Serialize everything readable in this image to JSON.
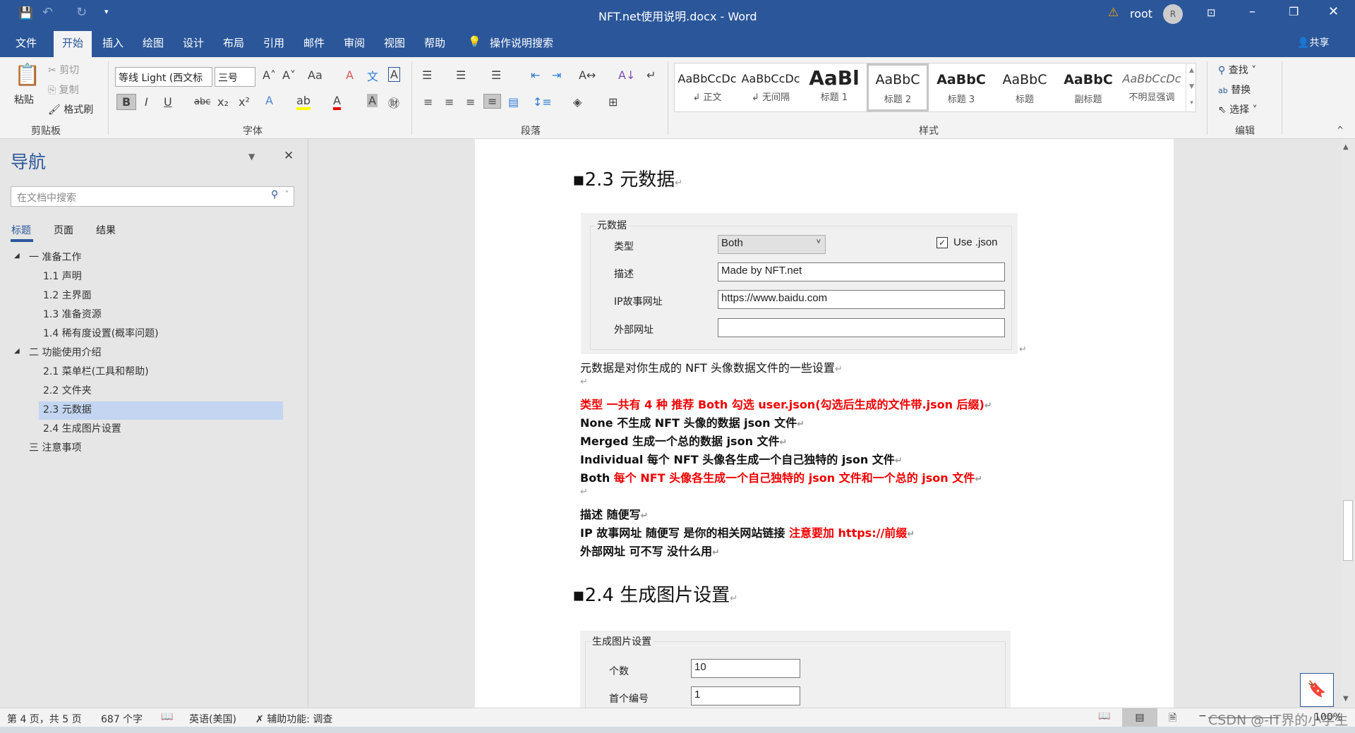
{
  "titlebar": {
    "title": "NFT.net使用说明.docx  -  Word",
    "user": "root",
    "avatar_initial": "R",
    "share": "共享"
  },
  "tabs": [
    "文件",
    "开始",
    "插入",
    "绘图",
    "设计",
    "布局",
    "引用",
    "邮件",
    "审阅",
    "视图",
    "帮助"
  ],
  "tell_me": "操作说明搜索",
  "ribbon": {
    "clipboard": {
      "paste": "粘贴",
      "cut": "剪切",
      "copy": "复制",
      "format_painter": "格式刷",
      "label": "剪贴板"
    },
    "font": {
      "name": "等线 Light (西文标",
      "size": "三号",
      "label": "字体"
    },
    "paragraph": {
      "label": "段落"
    },
    "styles": {
      "label": "样式",
      "items": [
        {
          "sample": "AaBbCcDc",
          "name": "↲ 正文"
        },
        {
          "sample": "AaBbCcDc",
          "name": "↲ 无间隔"
        },
        {
          "sample": "AaBl",
          "name": "标题 1"
        },
        {
          "sample": "AaBbC",
          "name": "标题 2"
        },
        {
          "sample": "AaBbC",
          "name": "标题 3"
        },
        {
          "sample": "AaBbC",
          "name": "标题"
        },
        {
          "sample": "AaBbC",
          "name": "副标题"
        },
        {
          "sample": "AaBbCcDc",
          "name": "不明显强调"
        }
      ]
    },
    "editing": {
      "find": "查找",
      "replace": "替换",
      "select": "选择",
      "label": "编辑"
    }
  },
  "nav": {
    "title": "导航",
    "search_placeholder": "在文档中搜索",
    "tabs": [
      "标题",
      "页面",
      "结果"
    ],
    "items": [
      {
        "label": "一 准备工作",
        "level": 1,
        "expanded": true
      },
      {
        "label": "1.1 声明",
        "level": 2
      },
      {
        "label": "1.2 主界面",
        "level": 2
      },
      {
        "label": "1.3 准备资源",
        "level": 2
      },
      {
        "label": "1.4 稀有度设置(概率问题)",
        "level": 2
      },
      {
        "label": "二 功能使用介绍",
        "level": 1,
        "expanded": true
      },
      {
        "label": "2.1 菜单栏(工具和帮助)",
        "level": 2
      },
      {
        "label": "2.2 文件夹",
        "level": 2
      },
      {
        "label": "2.3 元数据",
        "level": 2,
        "selected": true
      },
      {
        "label": "2.4 生成图片设置",
        "level": 2
      },
      {
        "label": "三 注意事项",
        "level": 1
      }
    ]
  },
  "doc": {
    "h23": "2.3  元数据",
    "form1": {
      "legend": "元数据",
      "type_label": "类型",
      "type_value": "Both",
      "use_json": "Use .json",
      "desc_label": "描述",
      "desc_value": "Made by NFT.net",
      "ip_label": "IP故事网址",
      "ip_value": "https://www.baidu.com",
      "ext_label": "外部网址",
      "ext_value": ""
    },
    "p1": "元数据是对你生成的 NFT 头像数据文件的一些设置",
    "p_type": "类型  一共有 4 种    推荐 Both    勾选 user.json(勾选后生成的文件带.json 后缀)",
    "p_none_k": "None",
    "p_none": "  不生成 NFT 头像的数据 json 文件",
    "p_merged_k": "Merged",
    "p_merged": "  生成一个总的数据 json 文件",
    "p_ind_k": "Individual",
    "p_ind": "  每个 NFT 头像各生成一个自己独特的 json 文件",
    "p_both_k": "Both",
    "p_both": "  每个 NFT 头像各生成一个自己独特的 json 文件和一个总的 json 文件",
    "p_desc": "描述  随便写",
    "p_ip": "IP 故事网址  随便写  是你的相关网站链接 ",
    "p_ip_red": "注意要加 https://前缀",
    "p_ext": "外部网址  可不写  没什么用",
    "h24": "2.4  生成图片设置",
    "form2": {
      "legend": "生成图片设置",
      "count_label": "个数",
      "count_value": "10",
      "first_label": "首个编号",
      "first_value": "1"
    }
  },
  "status": {
    "page": "第 4 页，共 5 页",
    "words": "687 个字",
    "language": "英语(美国)",
    "accessibility": "辅助功能: 调查",
    "zoom": "100%",
    "watermark": "CSDN @-IT界的小学生"
  }
}
